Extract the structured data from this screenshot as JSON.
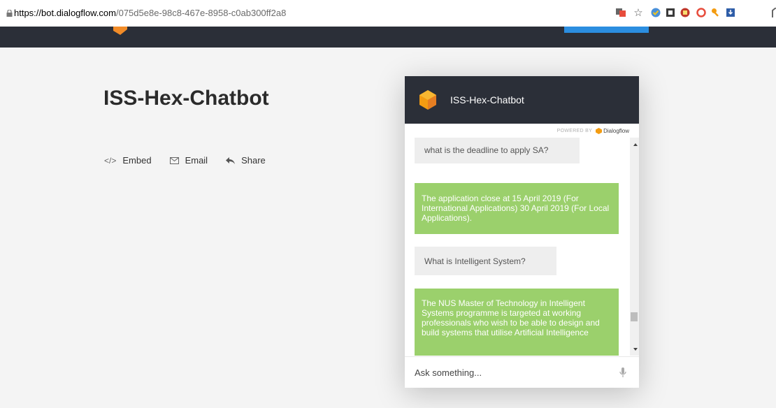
{
  "browser": {
    "url_host": "https://bot.dialogflow.com",
    "url_path": "/075d5e8e-98c8-467e-8958-c0ab300ff2a8"
  },
  "page": {
    "agent_title": "ISS-Hex-Chatbot",
    "actions": {
      "embed": "Embed",
      "email": "Email",
      "share": "Share"
    }
  },
  "widget": {
    "title": "ISS-Hex-Chatbot",
    "powered_by": "POWERED BY",
    "powered_brand": "Dialogflow",
    "messages": [
      {
        "from": "user",
        "text": "what is the deadline to apply SA?"
      },
      {
        "from": "bot",
        "text": "The application close at 15 April 2019 (For International Applications) 30 April 2019 (For Local Applications)."
      },
      {
        "from": "user",
        "text": "What is Intelligent System?"
      },
      {
        "from": "bot",
        "text": "The NUS Master of Technology in Intelligent Systems programme is targeted at working professionals who wish to be able to design and build systems that utilise Artificial Intelligence"
      }
    ],
    "input_placeholder": "Ask something..."
  },
  "colors": {
    "header_dark": "#2b2f38",
    "bot_bubble": "#9bd06c",
    "user_bubble": "#eeeeee",
    "accent_orange": "#f39c12"
  }
}
